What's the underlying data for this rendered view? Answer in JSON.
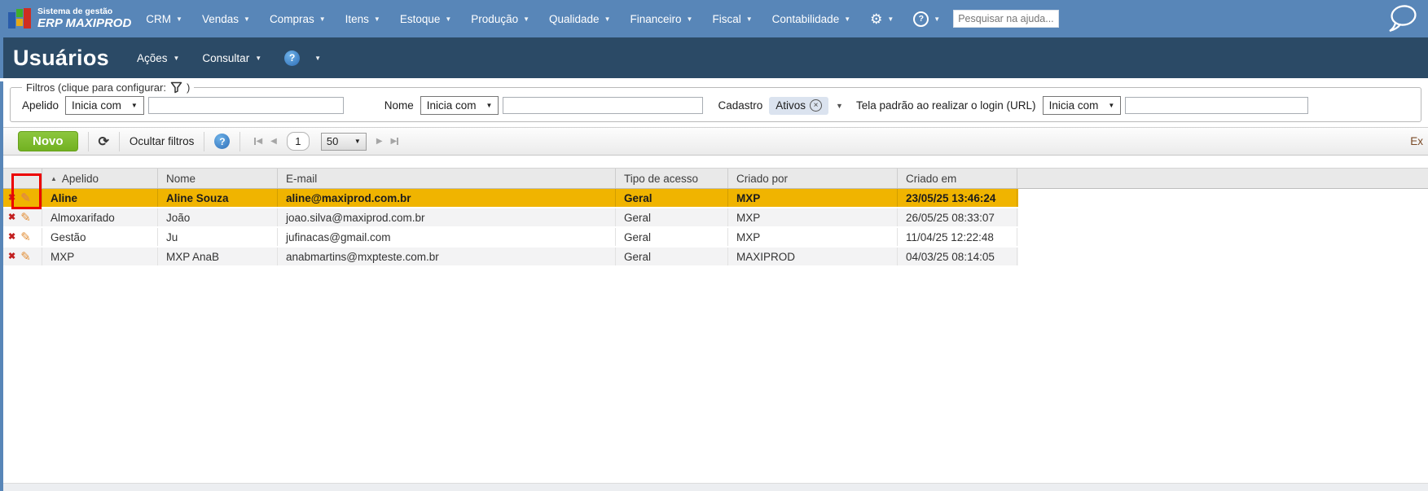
{
  "topbar": {
    "logo_line1": "Sistema de gestão",
    "logo_line2": "ERP MAXIPROD",
    "menus": [
      "CRM",
      "Vendas",
      "Compras",
      "Itens",
      "Estoque",
      "Produção",
      "Qualidade",
      "Financeiro",
      "Fiscal",
      "Contabilidade"
    ],
    "search_placeholder": "Pesquisar na ajuda..."
  },
  "titlebar": {
    "title": "Usuários",
    "acoes_label": "Ações",
    "consultar_label": "Consultar"
  },
  "filters": {
    "legend_prefix": "Filtros (clique para configurar:",
    "legend_suffix": ")",
    "apelido": {
      "label": "Apelido",
      "operator": "Inicia com",
      "value": ""
    },
    "nome": {
      "label": "Nome",
      "operator": "Inicia com",
      "value": ""
    },
    "cadastro": {
      "label": "Cadastro",
      "chip": "Ativos"
    },
    "tela": {
      "label": "Tela padrão ao realizar o login (URL)",
      "operator": "Inicia com",
      "value": ""
    }
  },
  "toolbar": {
    "novo_label": "Novo",
    "ocultar_label": "Ocultar filtros",
    "page": "1",
    "page_size": "50",
    "export_truncated": "Ex"
  },
  "table": {
    "columns": [
      "Apelido",
      "Nome",
      "E-mail",
      "Tipo de acesso",
      "Criado por",
      "Criado em"
    ],
    "sorted_by": "Apelido",
    "rows": [
      {
        "apelido": "Aline",
        "nome": "Aline Souza",
        "email": "aline@maxiprod.com.br",
        "tipo": "Geral",
        "criado_por": "MXP",
        "criado_em": "23/05/25 13:46:24",
        "selected": "true"
      },
      {
        "apelido": "Almoxarifado",
        "nome": "João",
        "email": "joao.silva@maxiprod.com.br",
        "tipo": "Geral",
        "criado_por": "MXP",
        "criado_em": "26/05/25 08:33:07",
        "selected": "false"
      },
      {
        "apelido": "Gestão",
        "nome": "Ju",
        "email": "jufinacas@gmail.com",
        "tipo": "Geral",
        "criado_por": "MXP",
        "criado_em": "11/04/25 12:22:48",
        "selected": "false"
      },
      {
        "apelido": "MXP",
        "nome": "MXP AnaB",
        "email": "anabmartins@mxpteste.com.br",
        "tipo": "Geral",
        "criado_por": "MAXIPROD",
        "criado_em": "04/03/25 08:14:05",
        "selected": "false"
      }
    ]
  },
  "icons": {
    "dropdown": "▼",
    "sort_asc": "▲",
    "gear": "⚙",
    "help": "?",
    "refresh": "⟳",
    "delete": "✖",
    "edit": "✎",
    "prev": "◀",
    "next": "▶",
    "close": "×"
  },
  "colors": {
    "topbar": "#5886b8",
    "titlebar": "#2b4a66",
    "novo_button": "#7cb52b",
    "selected_row": "#f0b400",
    "highlight_box": "#ec0000",
    "delete_icon": "#c21f1f",
    "edit_icon": "#e2903a"
  }
}
